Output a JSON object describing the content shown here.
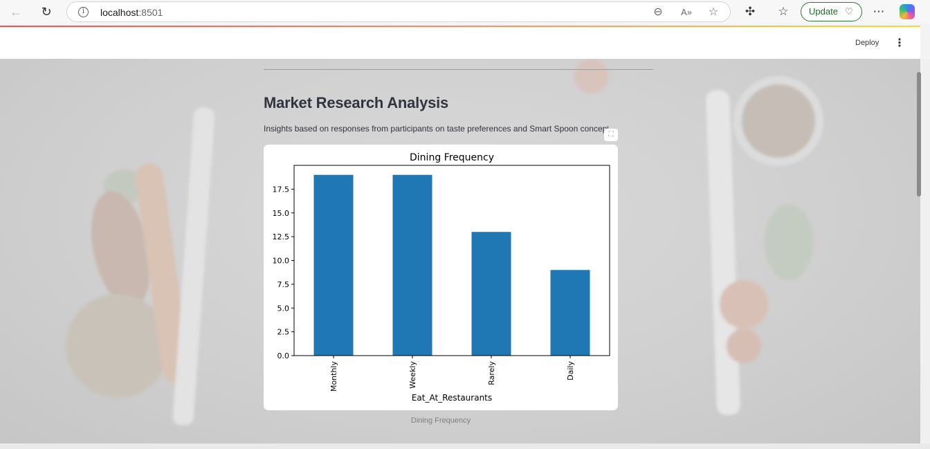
{
  "browser": {
    "url_host": "localhost",
    "url_port": ":8501",
    "update_label": "Update"
  },
  "header": {
    "deploy_label": "Deploy"
  },
  "main": {
    "title": "Market Research Analysis",
    "subtitle": "Insights based on responses from participants on taste preferences and Smart Spoon concept",
    "caption": "Dining Frequency"
  },
  "colors": {
    "bar": "#1f77b4",
    "accent": "#ff4b4b"
  },
  "chart_data": {
    "type": "bar",
    "title": "Dining Frequency",
    "xlabel": "Eat_At_Restaurants",
    "ylabel": "",
    "categories": [
      "Monthly",
      "Weekly",
      "Rarely",
      "Daily"
    ],
    "values": [
      19,
      19,
      13,
      9
    ],
    "ylim": [
      0,
      20
    ],
    "yticks": [
      "0.0",
      "2.5",
      "5.0",
      "7.5",
      "10.0",
      "12.5",
      "15.0",
      "17.5"
    ],
    "grid": false,
    "legend": "none"
  }
}
